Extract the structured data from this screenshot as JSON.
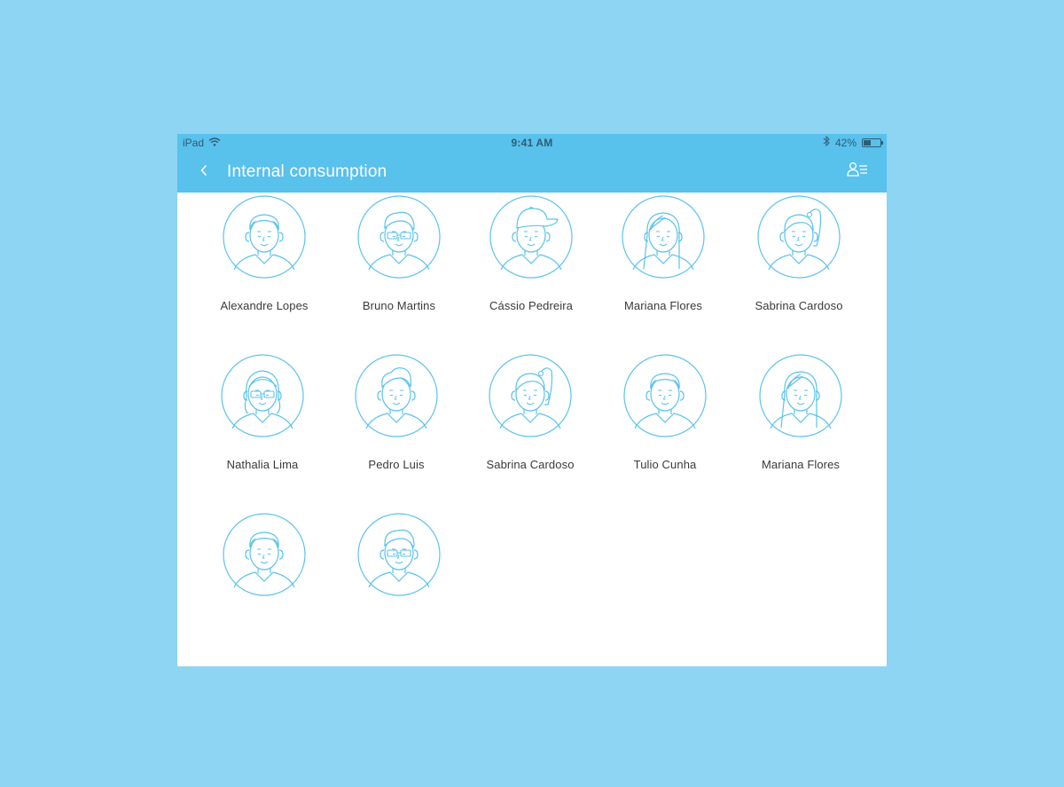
{
  "status_bar": {
    "device": "iPad",
    "time": "9:41 AM",
    "battery": "42%",
    "battery_level": 0.42
  },
  "header": {
    "title": "Internal consumption"
  },
  "people": [
    {
      "name": "Alexandre Lopes",
      "avatar": "man-short-hair"
    },
    {
      "name": "Bruno Martins",
      "avatar": "man-glasses"
    },
    {
      "name": "Cássio Pedreira",
      "avatar": "man-cap"
    },
    {
      "name": "Mariana Flores",
      "avatar": "woman-long-hair"
    },
    {
      "name": "Sabrina Cardoso",
      "avatar": "woman-ponytail"
    },
    {
      "name": "Nathalia Lima",
      "avatar": "woman-glasses"
    },
    {
      "name": "Pedro Luis",
      "avatar": "man-quiff"
    },
    {
      "name": "Sabrina Cardoso",
      "avatar": "woman-ponytail"
    },
    {
      "name": "Tulio Cunha",
      "avatar": "man-short-hair"
    },
    {
      "name": "Mariana Flores",
      "avatar": "woman-long-hair"
    },
    {
      "name": "",
      "avatar": "man-short-hair"
    },
    {
      "name": "",
      "avatar": "man-glasses"
    }
  ],
  "colors": {
    "background": "#8dd5f3",
    "bar": "#58c1ec",
    "avatar_stroke": "#5bc3ea"
  }
}
